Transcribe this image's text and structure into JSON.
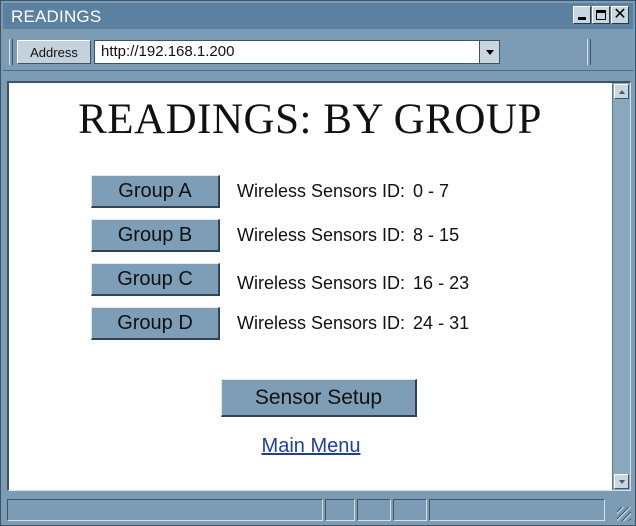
{
  "window": {
    "title": "READINGS"
  },
  "address_bar": {
    "label": "Address",
    "url": "http://192.168.1.200"
  },
  "page": {
    "title": "READINGS: BY GROUP",
    "groups": [
      {
        "button": "Group A",
        "description": "Wireless Sensors ID:",
        "ids": "0 - 7"
      },
      {
        "button": "Group B",
        "description": "Wireless Sensors ID:",
        "ids": "8 - 15"
      },
      {
        "button": "Group C",
        "description": "Wireless Sensors ID:",
        "ids": "16 - 23"
      },
      {
        "button": "Group D",
        "description": "Wireless Sensors ID:",
        "ids": "24 - 31"
      }
    ],
    "setup_button": "Sensor Setup",
    "main_menu_link": "Main Menu"
  },
  "colors": {
    "chrome": "#7b9cb4",
    "titlebar": "#5b80a0",
    "button": "#7d9eb6",
    "link": "#1f3f9c"
  },
  "icons": {
    "minimize": "minimize-icon",
    "maximize": "maximize-icon",
    "close": "close-icon",
    "dropdown": "chevron-down-icon",
    "scroll_up": "scroll-up-icon",
    "scroll_down": "scroll-down-icon",
    "resize": "resize-grip-icon"
  }
}
